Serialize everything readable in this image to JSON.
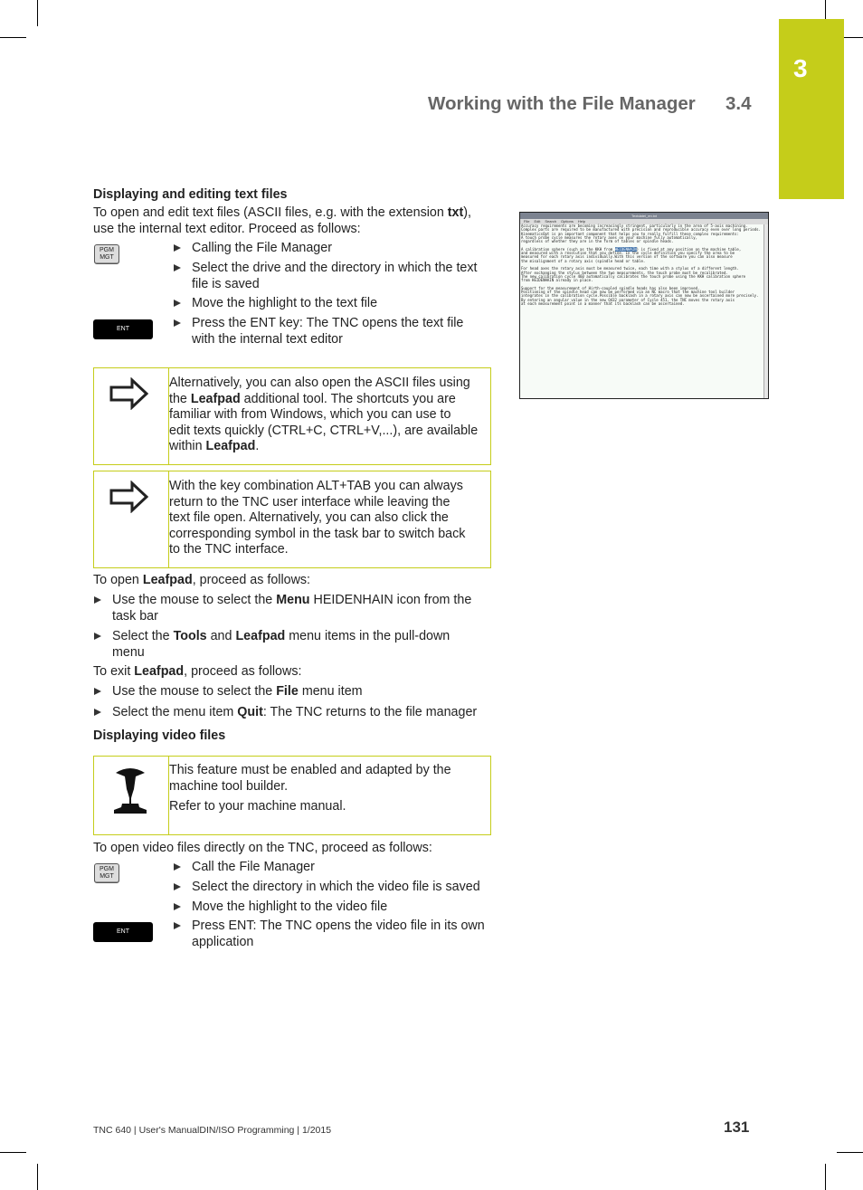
{
  "header": {
    "chapter_number": "3",
    "section_title": "Working with the File Manager",
    "section_number": "3.4",
    "accent_color": "#c5cd1a"
  },
  "text_files": {
    "heading": "Displaying and editing text files",
    "intro_1": "To open and edit text files (ASCII files, e.g. with the extension ",
    "intro_bold": "txt",
    "intro_2": "),",
    "intro_line2": "use the internal text editor. Proceed as follows:",
    "key_pgm_line1": "PGM",
    "key_pgm_line2": "MGT",
    "key_ent": "ENT",
    "steps": [
      "Calling the File Manager",
      "Select the drive and the directory in which the text",
      "file is saved",
      "Move the highlight to the text file",
      "Press the ENT key: The TNC opens the text file",
      "with the internal text editor"
    ]
  },
  "screenshot": {
    "window_title": "Textdatei_en.txt",
    "menu": [
      "File",
      "Edit",
      "Search",
      "Options",
      "Help"
    ],
    "lines": [
      "Accuracy requirements are becoming increasingly stringent, particularly in the area of 5-axis machining.",
      "Complex parts are required to be manufactured with precision and reproducible accuracy even over long periods.",
      "KinematicsOpt is an important component that helps you to really fulfill these complex requirements:",
      "A touch probe cycle measures the rotary axes on your machine fully automatically,",
      "regardless of whether they are in the form of tables or spindle heads.",
      "",
      "A calibration sphere (such as the KKH from HEIDENHAIN) is fixed at any position on the machine table,",
      "and measured with a resolution that you define. In the cycle definition you specify the area to be",
      "measured for each rotary axis individually.With this version of the software you can also measure",
      "the misalignment of a rotary axis (spindle head or table.",
      "",
      "For head axes the rotary axis must be measured twice, each time with a stylus of a different length.",
      "After exchanging the stylus between the two measurements, the touch probe must be recalibrated.",
      "The new calibration cycle 460 automatically calibrates the touch probe using the KKH calibration sphere",
      "from HEIDENHAIN already in place.",
      "",
      "Support for the measurement of Hirth-coupled spindle heads has also been improved.",
      "Positioning of the spindle head can now be performed via an NC macro that the machine tool builder",
      "integrates in the calibration cycle.Possible backlash in a rotary axis can now be ascertained more precisely.",
      "By entering an angular value in the new Q432 parameter of Cycle 451, the TNC moves the rotary axis",
      "at each measurement point in a manner that its backlash can be ascertained."
    ]
  },
  "note1": {
    "l1": "Alternatively, you can also open the ASCII files using",
    "l2a": "the ",
    "l2b": "Leafpad",
    "l2c": " additional tool. The shortcuts you are",
    "l3": "familiar with from Windows, which you can use to",
    "l4": "edit texts quickly (CTRL+C, CTRL+V,...), are available",
    "l5a": "within ",
    "l5b": "Leafpad",
    "l5c": "."
  },
  "note2": {
    "lines": [
      "With the key combination ALT+TAB you can always",
      "return to the TNC user interface while leaving the",
      "text file open. Alternatively, you can also click the",
      "corresponding symbol in the task bar to switch back",
      "to the TNC interface."
    ]
  },
  "leafpad": {
    "open_a": "To open ",
    "open_b": "Leafpad",
    "open_c": ", proceed as follows:",
    "s1a": "Use the mouse to select the ",
    "s1b": "Menu",
    "s1c": " HEIDENHAIN icon from the",
    "s1d": "task bar",
    "s2a": "Select the ",
    "s2b": "Tools",
    "s2c": " and ",
    "s2d": "Leafpad",
    "s2e": " menu items in the pull-down",
    "s2f": "menu",
    "exit_a": "To exit ",
    "exit_b": "Leafpad",
    "exit_c": ", proceed as follows:",
    "s3a": "Use the mouse to select the ",
    "s3b": "File",
    "s3c": " menu item",
    "s4a": "Select the menu item ",
    "s4b": "Quit",
    "s4c": ": The TNC returns to the file manager"
  },
  "video": {
    "heading": "Displaying video files",
    "note_l1": "This feature must be enabled and adapted by the",
    "note_l2": "machine tool builder.",
    "note_l3": "Refer to your machine manual.",
    "intro": "To open video files directly on the TNC, proceed as follows:",
    "key_pgm_line1": "PGM",
    "key_pgm_line2": "MGT",
    "key_ent": "ENT",
    "steps": [
      "Call the File Manager",
      "Select the directory in which the video file is saved",
      "Move the highlight to the video file",
      "Press ENT: The TNC opens the video file in its own",
      "application"
    ]
  },
  "footer": {
    "text": "TNC 640 | User's ManualDIN/ISO Programming | 1/2015",
    "page": "131"
  }
}
